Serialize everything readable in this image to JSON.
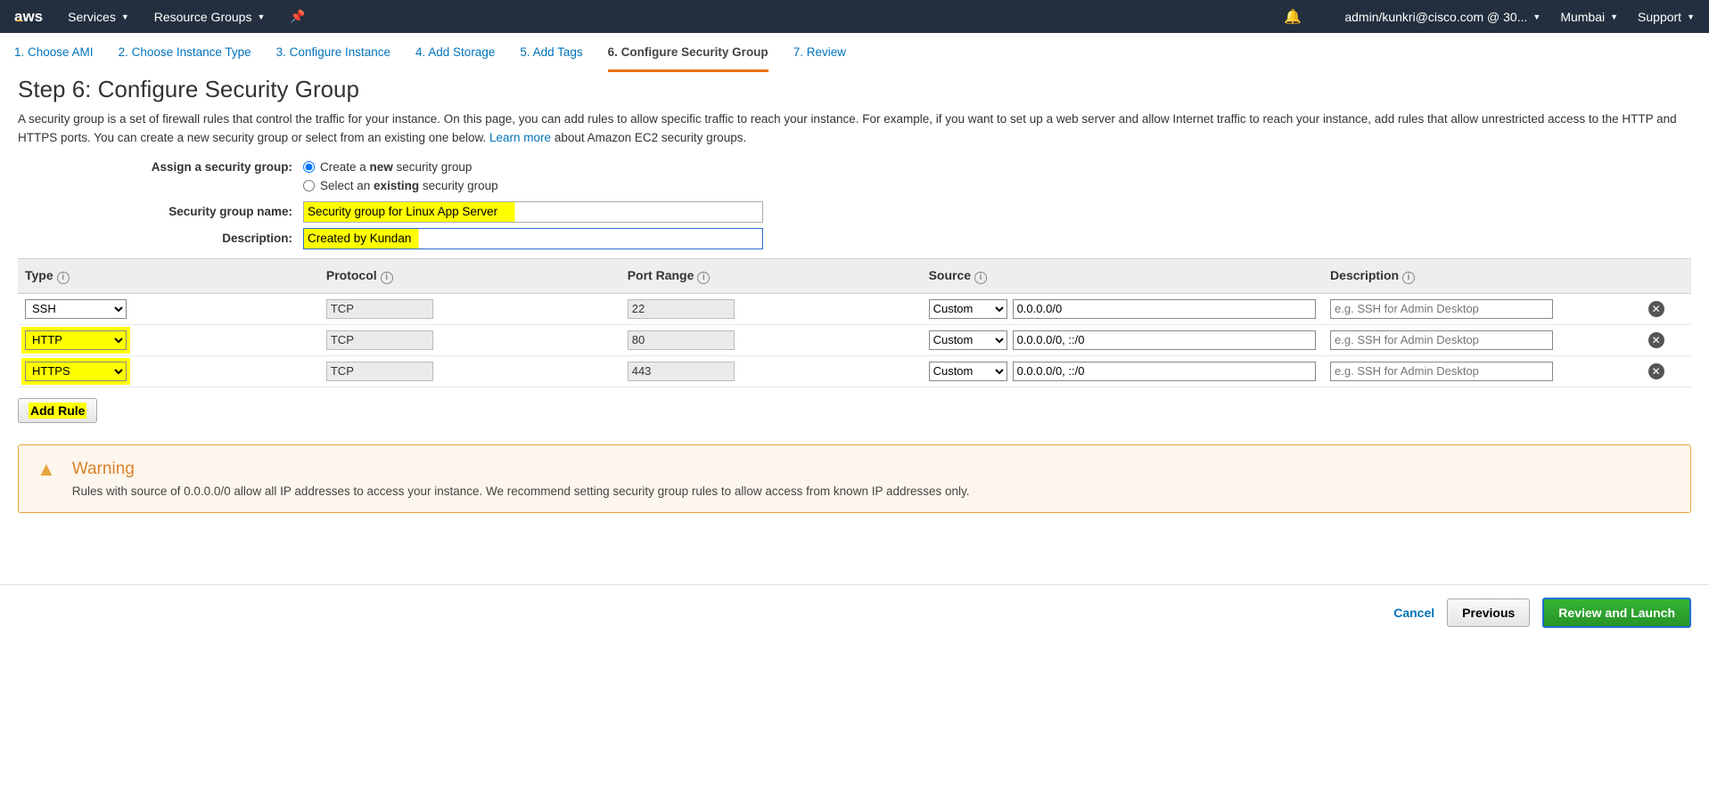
{
  "topnav": {
    "logo": "aws",
    "services": "Services",
    "resource_groups": "Resource Groups",
    "account": "admin/kunkri@cisco.com @ 30...",
    "region": "Mumbai",
    "support": "Support"
  },
  "tabs": [
    {
      "label": "1. Choose AMI"
    },
    {
      "label": "2. Choose Instance Type"
    },
    {
      "label": "3. Configure Instance"
    },
    {
      "label": "4. Add Storage"
    },
    {
      "label": "5. Add Tags"
    },
    {
      "label": "6. Configure Security Group",
      "active": true
    },
    {
      "label": "7. Review"
    }
  ],
  "page": {
    "title": "Step 6: Configure Security Group",
    "desc1": "A security group is a set of firewall rules that control the traffic for your instance. On this page, you can add rules to allow specific traffic to reach your instance. For example, if you want to set up a web server and allow Internet traffic to reach your instance, add rules that allow unrestricted access to the HTTP and HTTPS ports. You can create a new security group or select from an existing one below. ",
    "learn_more": "Learn more",
    "desc2": " about Amazon EC2 security groups."
  },
  "form": {
    "assign_label": "Assign a security group:",
    "create_prefix": "Create a ",
    "create_bold": "new",
    "create_suffix": " security group",
    "select_prefix": "Select an ",
    "select_bold": "existing",
    "select_suffix": " security group",
    "sg_name_label": "Security group name:",
    "sg_name_value": "Security group for Linux App Server",
    "sg_desc_label": "Description:",
    "sg_desc_value": "Created by Kundan"
  },
  "table": {
    "headers": {
      "type": "Type",
      "protocol": "Protocol",
      "port_range": "Port Range",
      "source": "Source",
      "description": "Description"
    },
    "rows": [
      {
        "type": "SSH",
        "protocol": "TCP",
        "port": "22",
        "source_mode": "Custom",
        "source_cidr": "0.0.0.0/0",
        "desc_placeholder": "e.g. SSH for Admin Desktop",
        "hl": false
      },
      {
        "type": "HTTP",
        "protocol": "TCP",
        "port": "80",
        "source_mode": "Custom",
        "source_cidr": "0.0.0.0/0, ::/0",
        "desc_placeholder": "e.g. SSH for Admin Desktop",
        "hl": true
      },
      {
        "type": "HTTPS",
        "protocol": "TCP",
        "port": "443",
        "source_mode": "Custom",
        "source_cidr": "0.0.0.0/0, ::/0",
        "desc_placeholder": "e.g. SSH for Admin Desktop",
        "hl": true
      }
    ],
    "add_rule": "Add Rule"
  },
  "warning": {
    "title": "Warning",
    "text": "Rules with source of 0.0.0.0/0 allow all IP addresses to access your instance. We recommend setting security group rules to allow access from known IP addresses only."
  },
  "footer": {
    "cancel": "Cancel",
    "previous": "Previous",
    "review_launch": "Review and Launch"
  }
}
